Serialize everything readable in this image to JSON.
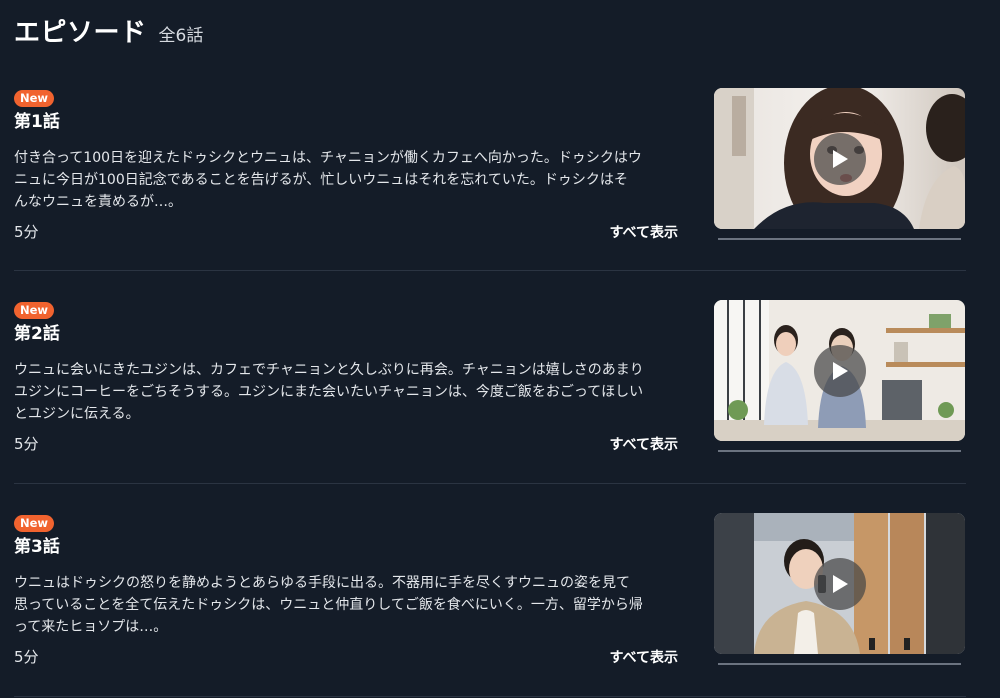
{
  "header": {
    "title": "エピソード",
    "count": "全6話"
  },
  "episodes": [
    {
      "badge": "New",
      "title": "第1話",
      "description": "付き合って100日を迎えたドゥシクとウニュは、チャニョンが働くカフェへ向かった。ドゥシクはウ\nニュに今日が100日記念であることを告げるが、忙しいウニュはそれを忘れていた。ドゥシクはそ\nんなウニュを責めるが…。",
      "duration": "5分",
      "show_all": "すべて表示"
    },
    {
      "badge": "New",
      "title": "第2話",
      "description": "ウニュに会いにきたユジンは、カフェでチャニョンと久しぶりに再会。チャニョンは嬉しさのあまり\nユジンにコーヒーをごちそうする。ユジンにまた会いたいチャニョンは、今度ご飯をおごってほしい\nとユジンに伝える。",
      "duration": "5分",
      "show_all": "すべて表示"
    },
    {
      "badge": "New",
      "title": "第3話",
      "description": "ウニュはドゥシクの怒りを静めようとあらゆる手段に出る。不器用に手を尽くすウニュの姿を見て\n思っていることを全て伝えたドゥシクは、ウニュと仲直りしてご飯を食べにいく。一方、留学から帰\nって来たヒョソプは…。",
      "duration": "5分",
      "show_all": "すべて表示"
    }
  ],
  "colors": {
    "background": "#141c28",
    "badge": "#f1632f",
    "divider": "#2b3442"
  },
  "icons": {
    "play": "play-icon"
  }
}
